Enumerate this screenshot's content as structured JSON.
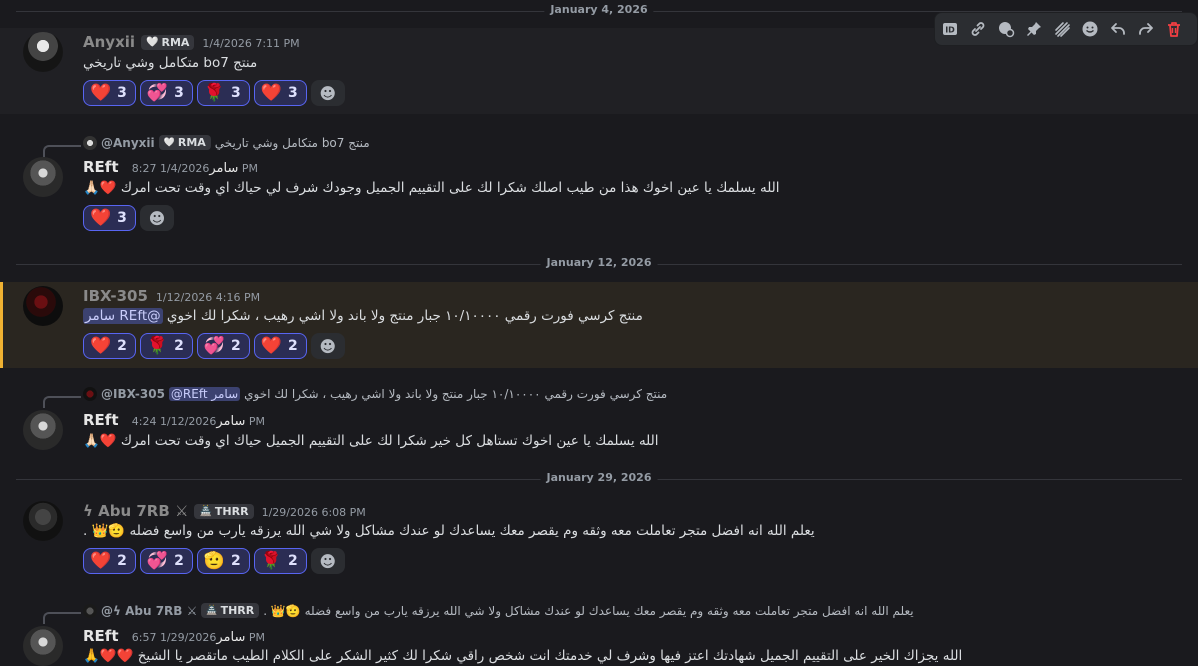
{
  "dividers": [
    "January 4, 2026",
    "January 12, 2026",
    "January 29, 2026"
  ],
  "colors": {
    "accent": "#5865f2",
    "highlight": "#f0b232",
    "delete": "#f23f43"
  },
  "toolbar": {
    "icons": [
      "id-icon",
      "link-icon",
      "reply-thread-icon",
      "pin-icon",
      "forward-icon",
      "add-reaction-icon",
      "reply-icon",
      "forward-arrow-icon",
      "delete-icon"
    ]
  },
  "messages": [
    {
      "author": "Anyxii",
      "tag": "RMA",
      "time": "1/4/2026 7:11 PM",
      "content": "منتج bo7 متكامل وشي تاريخي",
      "reactions": [
        {
          "emoji": "❤️",
          "count": "3"
        },
        {
          "emoji": "💞",
          "count": "3"
        },
        {
          "emoji": "🌹",
          "count": "3"
        },
        {
          "emoji": "❤️",
          "count": "3"
        }
      ]
    },
    {
      "reply": {
        "author": "@Anyxii",
        "tag": "RMA",
        "text": "منتج bo7 متكامل وشي تاريخي"
      },
      "author": "REft",
      "author_suffix": "سامر",
      "time": "1/4/2026 8:27 PM",
      "content": "الله يسلمك يا عين اخوك هذا من طيب اصلك شكرا لك على التقييم الجميل وجودك شرف لي حياك اي وقت تحت امرك ❤️🙏🏻",
      "reactions": [
        {
          "emoji": "❤️",
          "count": "3"
        }
      ]
    },
    {
      "author": "IBX-305",
      "time": "1/12/2026 4:16 PM",
      "content": "منتج كرسي فورت رقمي ١٠/١٠٠٠٠ جبار منتج ولا باند ولا اشي رهيب ، شكرا لك اخوي",
      "mention": "@REft سامر",
      "reactions": [
        {
          "emoji": "❤️",
          "count": "2"
        },
        {
          "emoji": "🌹",
          "count": "2"
        },
        {
          "emoji": "💞",
          "count": "2"
        },
        {
          "emoji": "❤️",
          "count": "2"
        }
      ]
    },
    {
      "reply": {
        "author": "@IBX-305",
        "mention": "@REft سامر",
        "text": "منتج كرسي فورت رقمي ١٠/١٠٠٠٠ جبار منتج ولا باند ولا اشي رهيب ، شكرا لك اخوي"
      },
      "author": "REft",
      "author_suffix": "سامر",
      "time": "1/12/2026 4:24 PM",
      "content": "الله يسلمك يا عين اخوك تستاهل كل خير شكرا لك على التقييم الجميل حياك اي وقت تحت امرك ❤️🙏🏻"
    },
    {
      "author": "ϟ Abu 7RB ⚔",
      "tag": "THRR",
      "time": "1/29/2026 6:08 PM",
      "content": "يعلم الله انه افضل متجر تعاملت معه وثقه وم يقصر معك يساعدك لو عندك مشاكل ولا شي الله يرزقه يارب من واسع فضله 🫡👑 .",
      "reactions": [
        {
          "emoji": "❤️",
          "count": "2"
        },
        {
          "emoji": "💞",
          "count": "2"
        },
        {
          "emoji": "🫡",
          "count": "2"
        },
        {
          "emoji": "🌹",
          "count": "2"
        }
      ]
    },
    {
      "reply": {
        "author": "@ϟ Abu 7RB ⚔",
        "tag": "THRR",
        "text": "يعلم الله انه افضل متجر تعاملت معه وثقه وم يقصر معك يساعدك لو عندك مشاكل ولا شي الله يرزقه يارب من واسع فضله 🫡👑 ."
      },
      "author": "REft",
      "author_suffix": "سامر",
      "time": "1/29/2026 6:57 PM",
      "content": "الله يجزاك الخير على التقييم الجميل شهادتك اعتز فيها وشرف لي خدمتك انت شخص راقي شكرا لك كثير الشكر على الكلام الطيب ماتقصر يا الشيخ ❤️❤️🙏"
    }
  ]
}
